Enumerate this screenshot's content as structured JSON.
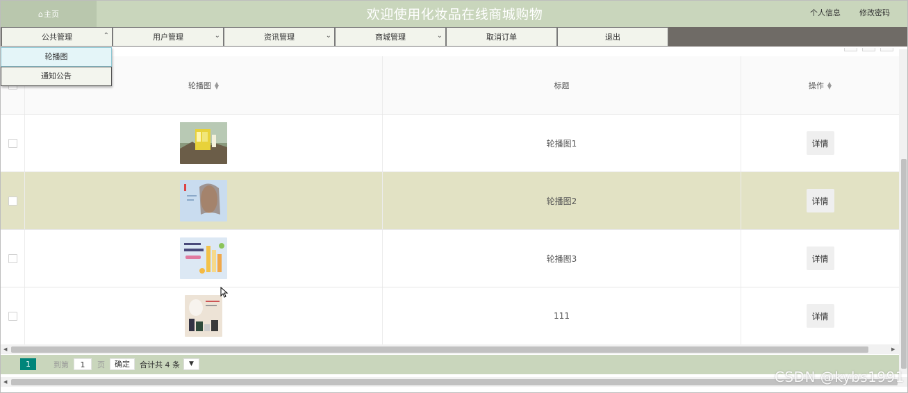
{
  "header": {
    "home_icon": "home-icon",
    "home_label": "主页",
    "title": "欢迎使用化妆品在线商城购物",
    "links": [
      "个人信息",
      "修改密码"
    ]
  },
  "nav": {
    "items": [
      {
        "label": "公共管理",
        "chevron": "^"
      },
      {
        "label": "用户管理",
        "chevron": "⌵"
      },
      {
        "label": "资讯管理",
        "chevron": "⌵"
      },
      {
        "label": "商城管理",
        "chevron": "⌵"
      },
      {
        "label": "取消订单",
        "chevron": ""
      },
      {
        "label": "退出",
        "chevron": ""
      }
    ],
    "dropdown": [
      "轮播图",
      "通知公告"
    ]
  },
  "table": {
    "headers": [
      "轮播图",
      "标题",
      "操作"
    ],
    "rows": [
      {
        "title": "轮播图1",
        "action": "详情",
        "highlighted": false
      },
      {
        "title": "轮播图2",
        "action": "详情",
        "highlighted": true
      },
      {
        "title": "轮播图3",
        "action": "详情",
        "highlighted": false
      },
      {
        "title": "111",
        "action": "详情",
        "highlighted": false
      }
    ]
  },
  "pagination": {
    "current_page": "1",
    "goto_label": "到第",
    "page_input": "1",
    "page_unit": "页",
    "confirm": "确定",
    "total": "合计共 4 条"
  },
  "watermark": "CSDN @kybs1991",
  "colors": {
    "header_bg": "#c9d6bc",
    "nav_bg": "#6f6b66",
    "highlight_row": "#e2e2c4",
    "pager_active": "#00857a"
  }
}
